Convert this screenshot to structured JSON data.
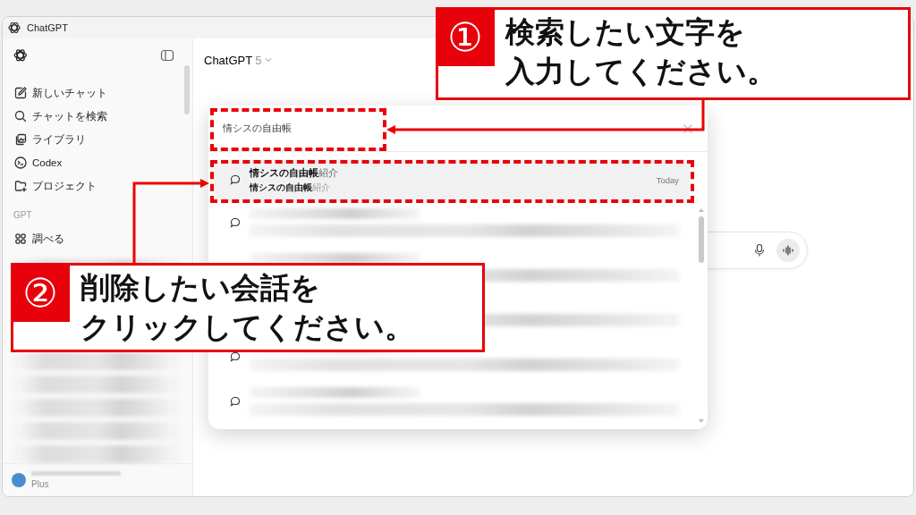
{
  "window": {
    "title": "ChatGPT"
  },
  "sidebar": {
    "items": [
      {
        "label": "新しいチャット",
        "kind": "new"
      },
      {
        "label": "チャットを検索",
        "kind": "search"
      },
      {
        "label": "ライブラリ",
        "kind": "library"
      },
      {
        "label": "Codex",
        "kind": "codex"
      },
      {
        "label": "プロジェクト",
        "kind": "project"
      }
    ],
    "section_label": "GPT",
    "gpt_items": [
      {
        "label": "調べる",
        "kind": "explore"
      }
    ],
    "account": {
      "plan": "Plus"
    }
  },
  "header": {
    "model": "ChatGPT",
    "version": "5"
  },
  "search_dialog": {
    "query": "情シスの自由帳",
    "results": [
      {
        "title": "**情シスの自由帳**紹介",
        "snippet": "**情シスの自由帳**紹介",
        "date": "Today",
        "selected": true
      }
    ]
  },
  "annotations": [
    {
      "number": "①",
      "lines": [
        "検索したい文字を",
        "入力してください。"
      ]
    },
    {
      "number": "②",
      "lines": [
        "削除したい会話を",
        "クリックしてください。"
      ]
    }
  ]
}
